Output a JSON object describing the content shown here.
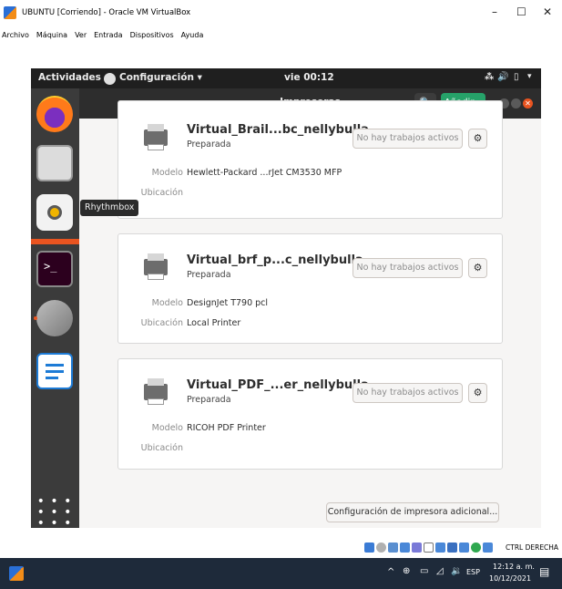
{
  "vbox": {
    "title": "UBUNTU [Corriendo] - Oracle VM VirtualBox",
    "menu": [
      "Archivo",
      "Máquina",
      "Ver",
      "Entrada",
      "Dispositivos",
      "Ayuda"
    ],
    "status_text": "CTRL DERECHA"
  },
  "gnome_topbar": {
    "activities": "Actividades",
    "app_menu": "Configuración ▾",
    "clock": "vie 00:12"
  },
  "headerbar": {
    "title": "Impresoras",
    "add_button": "Añadir..."
  },
  "dock": {
    "tooltip": "Rhythmbox",
    "icons": [
      "firefox-icon",
      "files-icon",
      "rhythmbox-icon",
      "terminal-icon",
      "settings-icon",
      "writer-icon",
      "show-apps-icon"
    ]
  },
  "printers": [
    {
      "name": "Virtual_Brail...bc_nellybulla",
      "state": "Preparada",
      "jobs": "No hay trabajos activos",
      "model_label": "Modelo",
      "model": "Hewlett-Packard ...rJet CM3530 MFP",
      "location_label": "Ubicación",
      "location": ""
    },
    {
      "name": "Virtual_brf_p...c_nellybulla",
      "state": "Preparada",
      "jobs": "No hay trabajos activos",
      "model_label": "Modelo",
      "model": "DesignJet T790 pcl",
      "location_label": "Ubicación",
      "location": "Local Printer"
    },
    {
      "name": "Virtual_PDF_...er_nellybulla",
      "state": "Preparada",
      "jobs": "No hay trabajos activos",
      "model_label": "Modelo",
      "model": "RICOH PDF Printer",
      "location_label": "Ubicación",
      "location": ""
    }
  ],
  "extra_button": "Configuración de impresora adicional...",
  "taskbar": {
    "lang": "ESP",
    "time": "12:12 a. m.",
    "date": "10/12/2021"
  }
}
